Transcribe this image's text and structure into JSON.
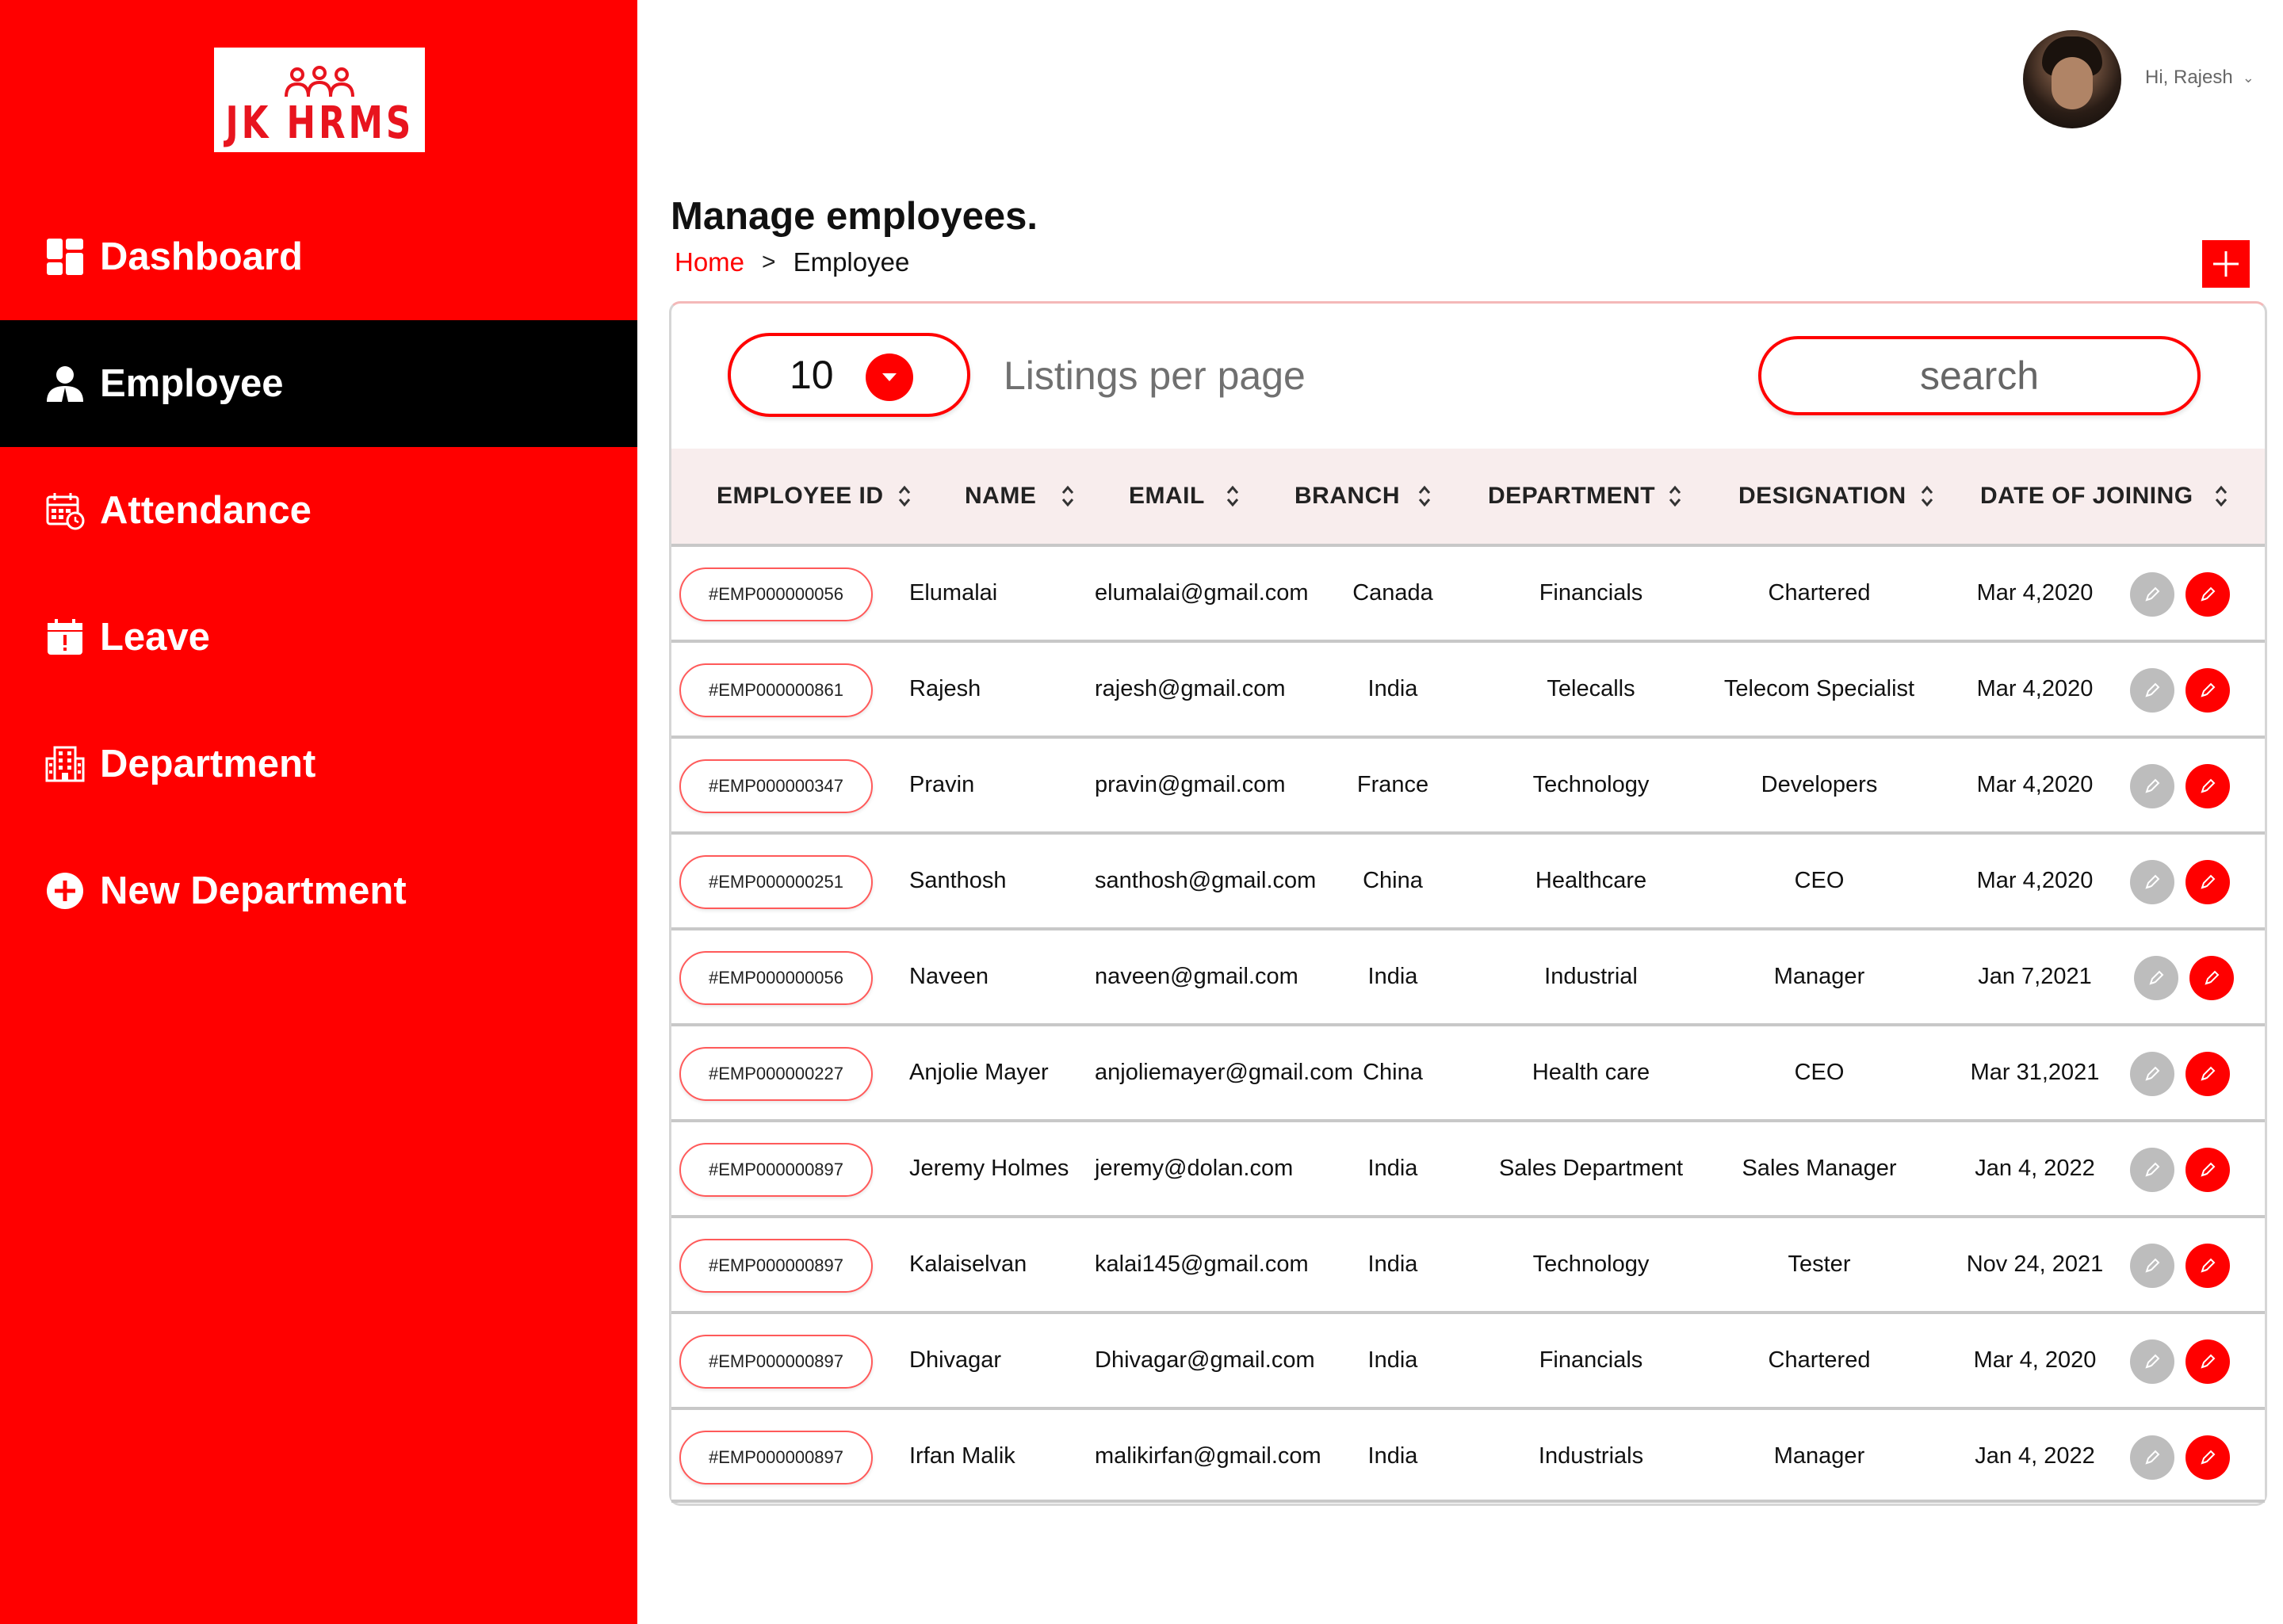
{
  "brand": {
    "logo_text": "JK HRMS"
  },
  "sidebar": {
    "items": [
      {
        "label": "Dashboard",
        "icon": "dashboard-icon"
      },
      {
        "label": "Employee",
        "icon": "employee-icon",
        "active": true
      },
      {
        "label": "Attendance",
        "icon": "calendar-clock-icon"
      },
      {
        "label": "Leave",
        "icon": "calendar-alert-icon"
      },
      {
        "label": "Department",
        "icon": "building-icon"
      },
      {
        "label": "New Department",
        "icon": "plus-circle-icon"
      }
    ]
  },
  "header": {
    "user_greeting": "Hi, Rajesh",
    "user_menu_icon": "chevron-down-icon"
  },
  "page": {
    "title": "Manage employees.",
    "breadcrumb": {
      "home": "Home",
      "separator": ">",
      "current": "Employee"
    }
  },
  "toolbar": {
    "per_page_value": "10",
    "per_page_label": "Listings per page",
    "search_placeholder": "search"
  },
  "table": {
    "columns": [
      "EMPLOYEE ID",
      "NAME",
      "EMAIL",
      "BRANCH",
      "DEPARTMENT",
      "DESIGNATION",
      "DATE OF JOINING"
    ],
    "rows": [
      {
        "id": "#EMP000000056",
        "name": "Elumalai",
        "email": "elumalai@gmail.com",
        "branch": "Canada",
        "department": "Financials",
        "designation": "Chartered",
        "doj": "Mar 4,2020"
      },
      {
        "id": "#EMP000000861",
        "name": "Rajesh",
        "email": "rajesh@gmail.com",
        "branch": "India",
        "department": "Telecalls",
        "designation": "Telecom Specialist",
        "doj": "Mar 4,2020"
      },
      {
        "id": "#EMP000000347",
        "name": "Pravin",
        "email": "pravin@gmail.com",
        "branch": "France",
        "department": "Technology",
        "designation": "Developers",
        "doj": "Mar 4,2020"
      },
      {
        "id": "#EMP000000251",
        "name": "Santhosh",
        "email": "santhosh@gmail.com",
        "branch": "China",
        "department": "Healthcare",
        "designation": "CEO",
        "doj": "Mar 4,2020"
      },
      {
        "id": "#EMP000000056",
        "name": "Naveen",
        "email": "naveen@gmail.com",
        "branch": "India",
        "department": "Industrial",
        "designation": "Manager",
        "doj": "Jan 7,2021"
      },
      {
        "id": "#EMP000000227",
        "name": "Anjolie Mayer",
        "email": "anjoliemayer@gmail.com",
        "branch": "China",
        "department": "Health care",
        "designation": "CEO",
        "doj": "Mar 31,2021"
      },
      {
        "id": "#EMP000000897",
        "name": "Jeremy Holmes",
        "email": "jeremy@dolan.com",
        "branch": "India",
        "department": "Sales Department",
        "designation": "Sales Manager",
        "doj": "Jan 4, 2022"
      },
      {
        "id": "#EMP000000897",
        "name": "Kalaiselvan",
        "email": "kalai145@gmail.com",
        "branch": "India",
        "department": "Technology",
        "designation": "Tester",
        "doj": "Nov 24, 2021"
      },
      {
        "id": "#EMP000000897",
        "name": "Dhivagar",
        "email": "Dhivagar@gmail.com",
        "branch": "India",
        "department": "Financials",
        "designation": "Chartered",
        "doj": "Mar 4, 2020"
      },
      {
        "id": "#EMP000000897",
        "name": "Irfan Malik",
        "email": "malikirfan@gmail.com",
        "branch": "India",
        "department": "Industrials",
        "designation": "Manager",
        "doj": "Jan 4, 2022"
      }
    ]
  },
  "colors": {
    "accent": "#ff0000",
    "active_nav": "#000000",
    "header_row": "#f8eded",
    "muted_button": "#bdbdbd"
  }
}
